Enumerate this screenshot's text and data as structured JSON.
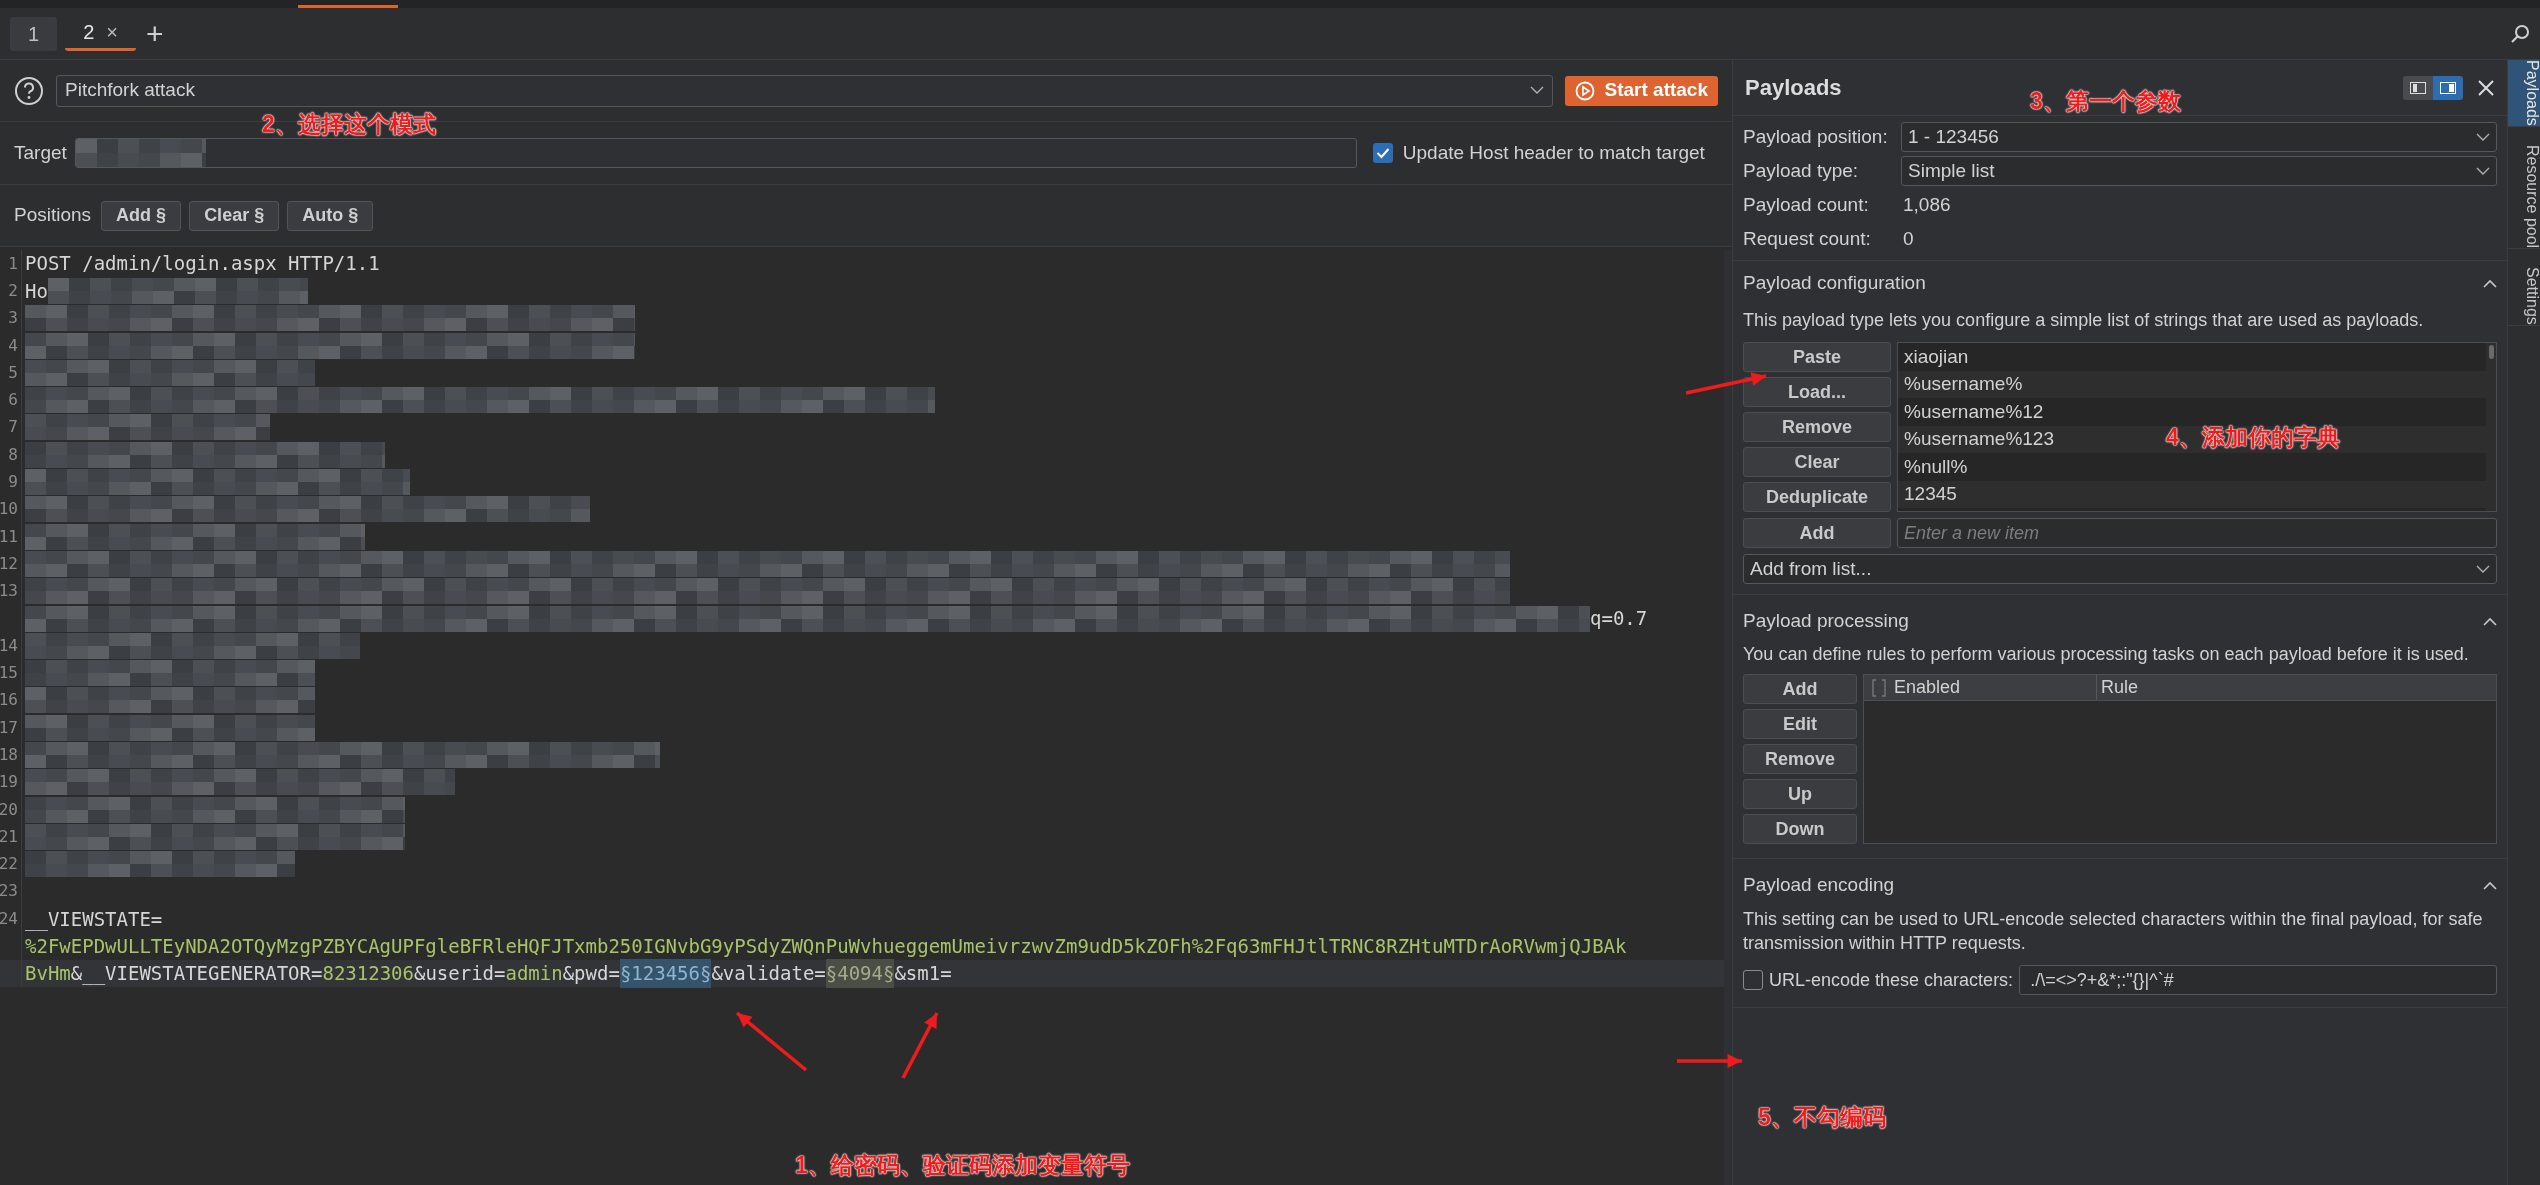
{
  "top_tabs": [
    {
      "label": "1",
      "selected": false
    },
    {
      "label": "2",
      "selected": true,
      "close": "×"
    }
  ],
  "new_tab": "+",
  "attack": {
    "type": "Pitchfork attack",
    "start": "Start attack"
  },
  "target": {
    "label": "Target",
    "redacted": true,
    "update_host": {
      "label": "Update Host header to match target",
      "checked": true
    }
  },
  "positions": {
    "label": "Positions",
    "buttons": [
      "Add §",
      "Clear §",
      "Auto §"
    ]
  },
  "editor": {
    "lines": [
      {
        "number": "1",
        "rows": [
          {
            "current": false,
            "segments": [
              {
                "kind": "plain",
                "text": "POST /admin/login.aspx HTTP/1.1"
              }
            ]
          }
        ]
      },
      {
        "number": "2",
        "rows": [
          {
            "current": false,
            "segments": [
              {
                "kind": "plain",
                "text": "Ho"
              },
              {
                "kind": "redacted"
              }
            ]
          }
        ]
      },
      {
        "number": "3",
        "rows": [
          {
            "current": false,
            "segments": [
              {
                "kind": "redacted"
              }
            ]
          }
        ]
      },
      {
        "number": "4",
        "rows": [
          {
            "current": false,
            "segments": [
              {
                "kind": "redacted"
              }
            ]
          }
        ]
      },
      {
        "number": "5",
        "rows": [
          {
            "current": false,
            "segments": [
              {
                "kind": "redacted"
              }
            ]
          }
        ]
      },
      {
        "number": "6",
        "rows": [
          {
            "current": false,
            "segments": [
              {
                "kind": "redacted"
              }
            ]
          }
        ]
      },
      {
        "number": "7",
        "rows": [
          {
            "current": false,
            "segments": [
              {
                "kind": "redacted"
              }
            ]
          }
        ]
      },
      {
        "number": "8",
        "rows": [
          {
            "current": false,
            "segments": [
              {
                "kind": "redacted"
              }
            ]
          }
        ]
      },
      {
        "number": "9",
        "rows": [
          {
            "current": false,
            "segments": [
              {
                "kind": "redacted"
              }
            ]
          }
        ]
      },
      {
        "number": "10",
        "rows": [
          {
            "current": false,
            "segments": [
              {
                "kind": "redacted"
              }
            ]
          }
        ]
      },
      {
        "number": "11",
        "rows": [
          {
            "current": false,
            "segments": [
              {
                "kind": "redacted"
              }
            ]
          }
        ]
      },
      {
        "number": "12",
        "rows": [
          {
            "current": false,
            "segments": [
              {
                "kind": "redacted"
              }
            ]
          }
        ]
      },
      {
        "number": "13",
        "rows": [
          {
            "current": false,
            "segments": [
              {
                "kind": "redacted"
              }
            ]
          },
          {
            "current": false,
            "segments": [
              {
                "kind": "redacted"
              },
              {
                "kind": "plain",
                "text": "q=0.7"
              }
            ]
          }
        ]
      },
      {
        "number": "14",
        "rows": [
          {
            "current": false,
            "segments": [
              {
                "kind": "redacted"
              }
            ]
          }
        ]
      },
      {
        "number": "15",
        "rows": [
          {
            "current": false,
            "segments": [
              {
                "kind": "redacted"
              }
            ]
          }
        ]
      },
      {
        "number": "16",
        "rows": [
          {
            "current": false,
            "segments": [
              {
                "kind": "redacted"
              }
            ]
          }
        ]
      },
      {
        "number": "17",
        "rows": [
          {
            "current": false,
            "segments": [
              {
                "kind": "redacted"
              }
            ]
          }
        ]
      },
      {
        "number": "18",
        "rows": [
          {
            "current": false,
            "segments": [
              {
                "kind": "redacted"
              }
            ]
          }
        ]
      },
      {
        "number": "19",
        "rows": [
          {
            "current": false,
            "segments": [
              {
                "kind": "redacted"
              }
            ]
          }
        ]
      },
      {
        "number": "20",
        "rows": [
          {
            "current": false,
            "segments": [
              {
                "kind": "redacted"
              }
            ]
          }
        ]
      },
      {
        "number": "21",
        "rows": [
          {
            "current": false,
            "segments": [
              {
                "kind": "redacted"
              }
            ]
          }
        ]
      },
      {
        "number": "22",
        "rows": [
          {
            "current": false,
            "segments": [
              {
                "kind": "redacted"
              }
            ]
          }
        ]
      },
      {
        "number": "23",
        "rows": [
          {
            "current": false,
            "segments": []
          }
        ]
      },
      {
        "number": "24",
        "rows": [
          {
            "current": false,
            "segments": [
              {
                "kind": "plain",
                "text": "__VIEWSTATE="
              }
            ]
          },
          {
            "current": false,
            "segments": [
              {
                "kind": "value",
                "text": "%2FwEPDwULLTEyNDA2OTQyMzgPZBYCAgUPFgleBFRleHQFJTxmb250IGNvbG9yPSdyZWQnPuWvhueggemUmeivrzwvZm9udD5kZOFh%2Fq63mFHJtlTRNC8RZHtuMTDrAoRVwmjQJBAk"
              }
            ]
          },
          {
            "current": true,
            "segments": [
              {
                "kind": "value",
                "text": "BvHm"
              },
              {
                "kind": "plain",
                "text": "&__VIEWSTATEGENERATOR="
              },
              {
                "kind": "value",
                "text": "82312306"
              },
              {
                "kind": "plain",
                "text": "&userid="
              },
              {
                "kind": "value",
                "text": "admin"
              },
              {
                "kind": "plain",
                "text": "&pwd="
              },
              {
                "kind": "marker",
                "text": "§123456§",
                "selected": true
              },
              {
                "kind": "plain",
                "text": "&validate="
              },
              {
                "kind": "marker",
                "text": "§4094§",
                "selected": false
              },
              {
                "kind": "plain",
                "text": "&sm1="
              }
            ]
          }
        ]
      }
    ]
  },
  "payloads": {
    "title": "Payloads",
    "fields": [
      {
        "label": "Payload position:",
        "kind": "dropdown",
        "value": "1 - 123456"
      },
      {
        "label": "Payload type:",
        "kind": "dropdown",
        "value": "Simple list"
      },
      {
        "label": "Payload count:",
        "kind": "text",
        "value": "1,086"
      },
      {
        "label": "Request count:",
        "kind": "text",
        "value": "0"
      }
    ],
    "configuration": {
      "title": "Payload configuration",
      "expanded": true,
      "description": "This payload type lets you configure a simple list of strings that are used as payloads.",
      "buttons": [
        "Paste",
        "Load...",
        "Remove",
        "Clear",
        "Deduplicate"
      ],
      "items": [
        "xiaojian",
        "%username%",
        "%username%12",
        "%username%123",
        "%null%",
        "12345"
      ],
      "add_button": "Add",
      "add_placeholder": "Enter a new item",
      "add_from_list": "Add from list..."
    },
    "processing": {
      "title": "Payload processing",
      "expanded": true,
      "description": "You can define rules to perform various processing tasks on each payload before it is used.",
      "buttons": [
        "Add",
        "Edit",
        "Remove",
        "Up",
        "Down"
      ],
      "columns": [
        "Enabled",
        "Rule"
      ]
    },
    "encoding": {
      "title": "Payload encoding",
      "expanded": true,
      "description": "This setting can be used to URL-encode selected characters within the final payload, for safe transmission within HTTP requests.",
      "checkbox": {
        "label": "URL-encode these characters:",
        "checked": false
      },
      "characters": "./\\=<>?+&*;:\"{}|^`#"
    }
  },
  "side_tabs": [
    {
      "label": "Payloads",
      "selected": true
    },
    {
      "label": "Resource pool",
      "selected": false
    },
    {
      "label": "Settings",
      "selected": false
    }
  ],
  "annotations": [
    {
      "text": "2、选择这个模式"
    },
    {
      "text": "3、第一个参数"
    },
    {
      "text": "4、添加你的字典"
    },
    {
      "text": "1、给密码、验证码添加变量符号"
    },
    {
      "text": "5、不勾编码"
    }
  ]
}
